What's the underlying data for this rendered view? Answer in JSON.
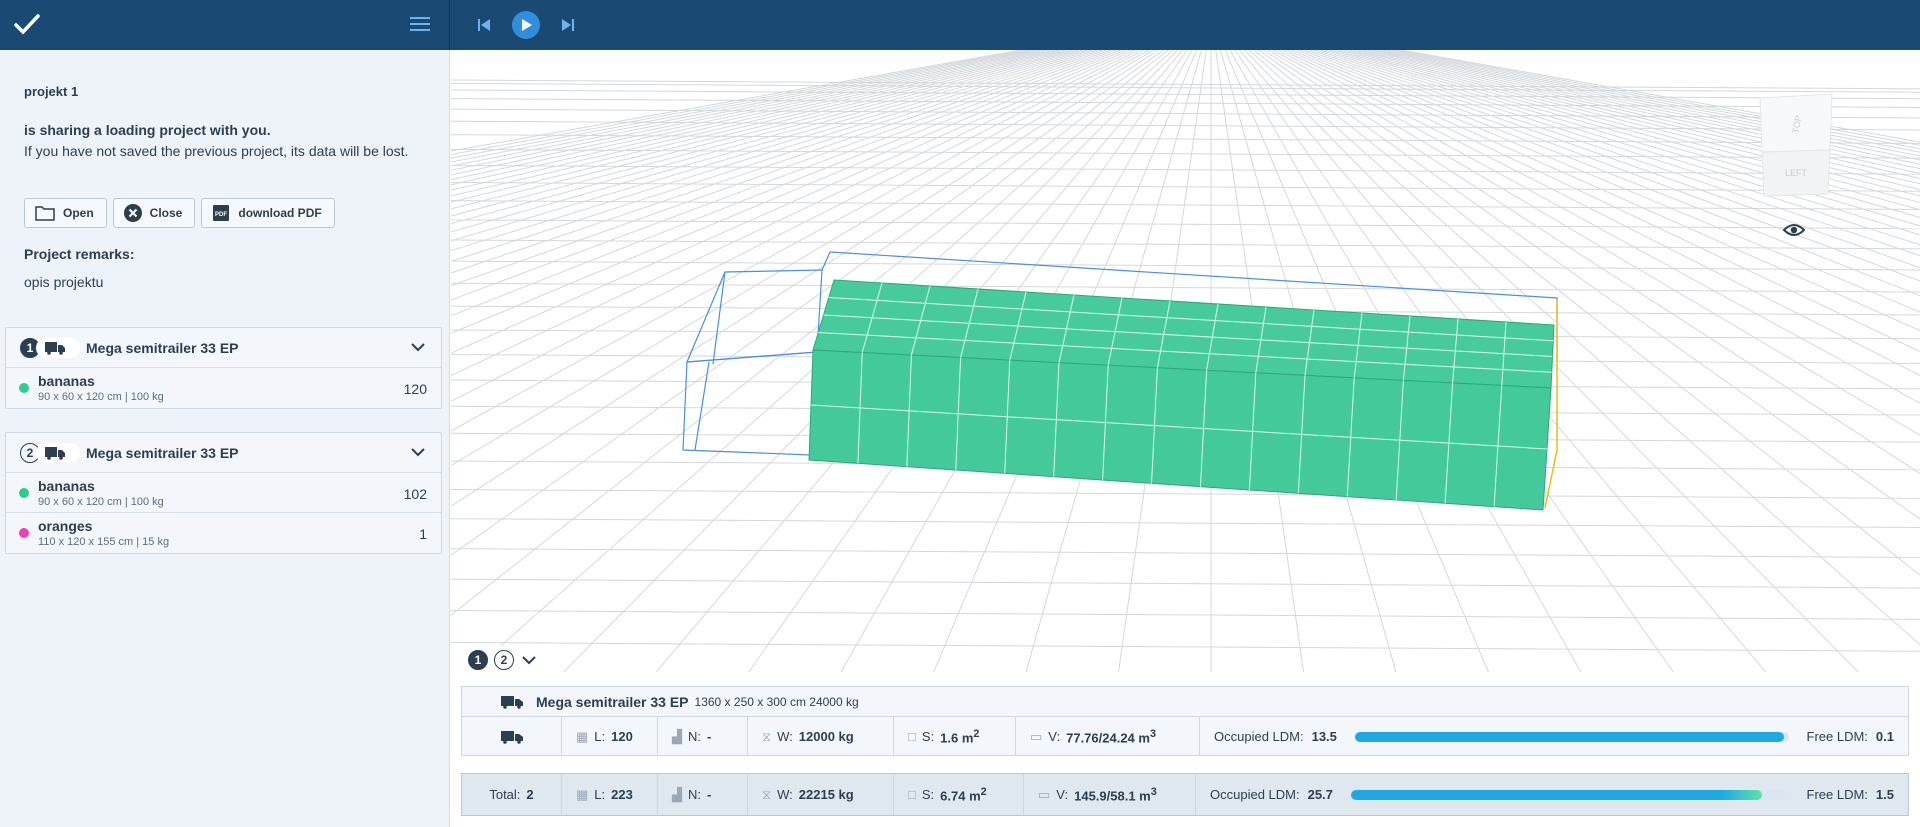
{
  "header": {
    "logo_icon": "check-logo-icon",
    "menu_icon": "hamburger-menu-icon",
    "player": [
      "skip-back-icon",
      "play-icon",
      "skip-forward-icon"
    ]
  },
  "sidebar": {
    "project_name": "projekt 1",
    "share_bold": "is sharing a loading project with you.",
    "share_text": "If you have not saved the previous project, its data will be lost.",
    "buttons": {
      "open": "Open",
      "close": "Close",
      "pdf": "download PDF"
    },
    "remarks_label": "Project remarks:",
    "remarks": "opis projektu",
    "vehicles": [
      {
        "num": "1",
        "name": "Mega semitrailer 33 EP",
        "items": [
          {
            "name": "bananas",
            "desc": "90 x 60 x 120 cm | 100 kg",
            "qty": "120",
            "color": "#2ecc8e"
          }
        ]
      },
      {
        "num": "2",
        "name": "Mega semitrailer 33 EP",
        "items": [
          {
            "name": "bananas",
            "desc": "90 x 60 x 120 cm | 100 kg",
            "qty": "102",
            "color": "#2ecc8e"
          },
          {
            "name": "oranges",
            "desc": "110 x 120 x 155 cm | 15 kg",
            "qty": "1",
            "color": "#f03fb7"
          }
        ]
      }
    ]
  },
  "viewport": {
    "viewcube_top": "TOP",
    "viewcube_left": "LEFT",
    "cargo_color": "#42c99a",
    "tabs": [
      "1",
      "2"
    ]
  },
  "vehicle_info": {
    "name": "Mega semitrailer 33 EP",
    "dims": "1360 x 250 x 300 cm 24000 kg",
    "L_label": "L:",
    "L": "120",
    "N_label": "N:",
    "N": "-",
    "W_label": "W:",
    "W": "12000 kg",
    "S_label": "S:",
    "S": "1.6 m",
    "V_label": "V:",
    "V": "77.76/24.24 m",
    "occ_label": "Occupied LDM:",
    "occ": "13.5",
    "free_label": "Free LDM:",
    "free": "0.1",
    "occupied_fraction": 0.99
  },
  "totals": {
    "total_label": "Total:",
    "total": "2",
    "L": "223",
    "N": "-",
    "W": "22215 kg",
    "S": "6.74 m",
    "V": "145.9/58.1 m",
    "occ": "25.7",
    "free": "1.5",
    "occupied_fraction": 0.94
  }
}
